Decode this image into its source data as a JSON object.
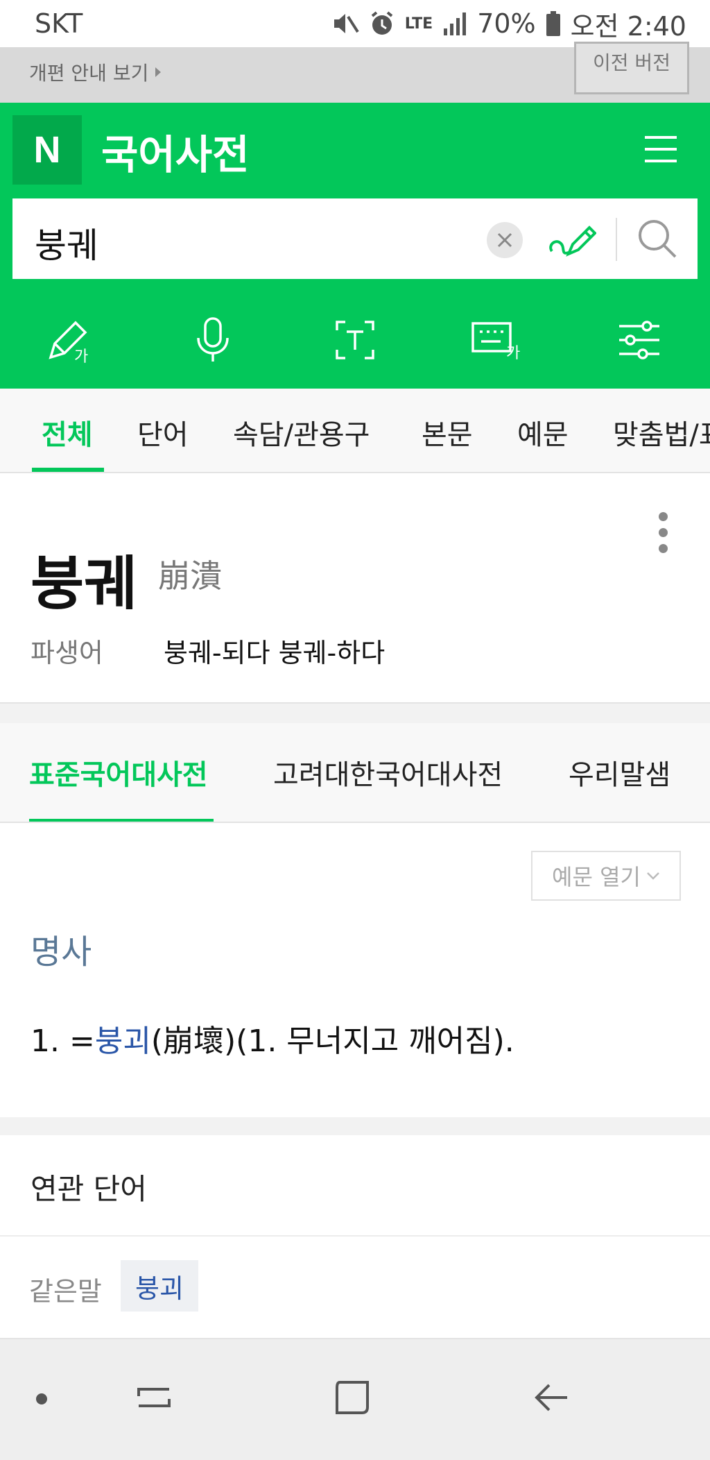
{
  "status": {
    "carrier": "SKT",
    "network": "LTE",
    "battery": "70%",
    "time": "오전 2:40"
  },
  "banner": {
    "guide": "개편 안내 보기",
    "old_version": "이전 버전"
  },
  "header": {
    "logo": "N",
    "title": "국어사전"
  },
  "search": {
    "query": "붕궤"
  },
  "tools": [
    {
      "name": "handwriting-input"
    },
    {
      "name": "voice-input"
    },
    {
      "name": "text-recognition"
    },
    {
      "name": "keyboard-input"
    },
    {
      "name": "filter-settings"
    }
  ],
  "category_tabs": [
    "전체",
    "단어",
    "속담/관용구",
    "본문",
    "예문",
    "맞춤법/표"
  ],
  "entry": {
    "headword": "붕궤",
    "hanja": "崩潰",
    "derivative_label": "파생어",
    "derivatives": "붕궤-되다 붕궤-하다"
  },
  "dict_tabs": [
    "표준국어대사전",
    "고려대한국어대사전",
    "우리말샘"
  ],
  "definition": {
    "example_button": "예문 열기",
    "pos": "명사",
    "number": "1.",
    "eq": "=",
    "link": "붕괴",
    "rest": "(崩壞)(1. 무너지고 깨어짐)."
  },
  "related": {
    "title": "연관 단어",
    "synonym_label": "같은말",
    "synonym": "붕괴"
  },
  "colors": {
    "accent": "#03c75a",
    "link": "#2a56a8",
    "pos": "#5a7896"
  }
}
